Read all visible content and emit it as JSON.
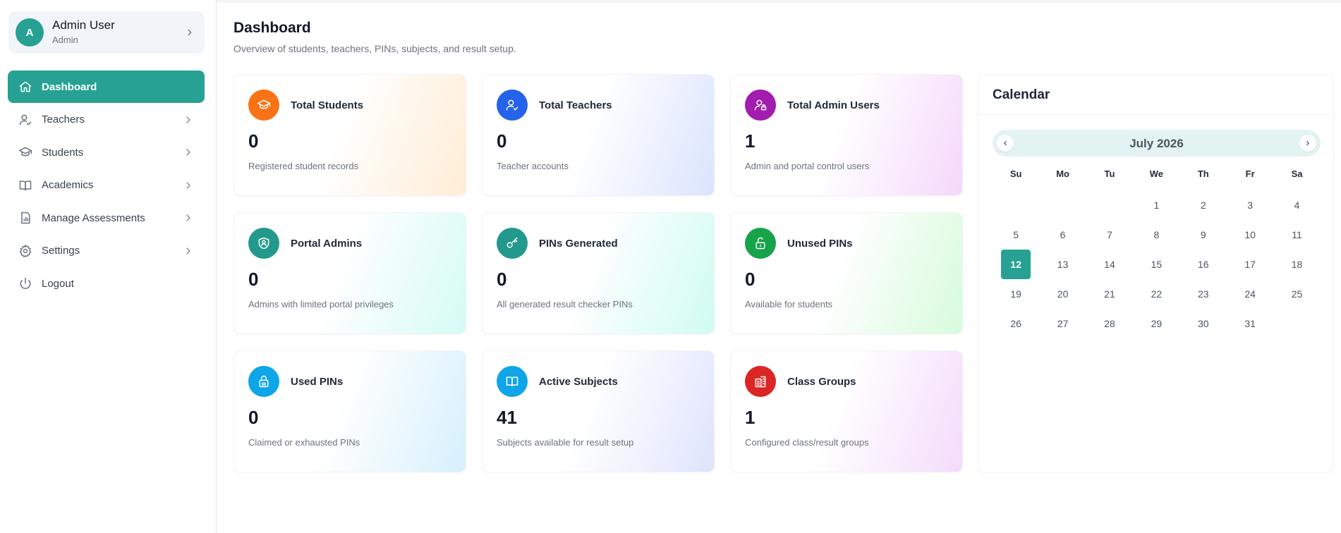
{
  "user": {
    "initial": "A",
    "name": "Admin User",
    "role": "Admin"
  },
  "nav": [
    {
      "label": "Dashboard",
      "icon": "home-icon",
      "active": true,
      "chevron": false
    },
    {
      "label": "Teachers",
      "icon": "user-check-icon",
      "active": false,
      "chevron": true
    },
    {
      "label": "Students",
      "icon": "graduation-cap-icon",
      "active": false,
      "chevron": true
    },
    {
      "label": "Academics",
      "icon": "book-open-icon",
      "active": false,
      "chevron": true
    },
    {
      "label": "Manage Assessments",
      "icon": "report-chart-icon",
      "active": false,
      "chevron": true
    },
    {
      "label": "Settings",
      "icon": "gear-icon",
      "active": false,
      "chevron": true
    },
    {
      "label": "Logout",
      "icon": "power-icon",
      "active": false,
      "chevron": false
    }
  ],
  "page": {
    "title": "Dashboard",
    "subtitle": "Overview of students, teachers, PINs, subjects, and result setup."
  },
  "cards": [
    {
      "title": "Total Students",
      "value": "0",
      "desc": "Registered student records",
      "icon": "graduation-cap-icon",
      "color": "#f97316",
      "tint": "#ffedd5"
    },
    {
      "title": "Total Teachers",
      "value": "0",
      "desc": "Teacher accounts",
      "icon": "user-check-icon",
      "color": "#2563eb",
      "tint": "#dbe4fe"
    },
    {
      "title": "Total Admin Users",
      "value": "1",
      "desc": "Admin and portal control users",
      "icon": "user-lock-icon",
      "color": "#a21caf",
      "tint": "#f5d8fb"
    },
    {
      "title": "Portal Admins",
      "value": "0",
      "desc": "Admins with limited portal privileges",
      "icon": "shield-user-icon",
      "color": "#22998c",
      "tint": "#d5fbf4"
    },
    {
      "title": "PINs Generated",
      "value": "0",
      "desc": "All generated result checker PINs",
      "icon": "key-icon",
      "color": "#22998c",
      "tint": "#cffcf2"
    },
    {
      "title": "Unused PINs",
      "value": "0",
      "desc": "Available for students",
      "icon": "unlock-icon",
      "color": "#16a34a",
      "tint": "#d7fbdc"
    },
    {
      "title": "Used PINs",
      "value": "0",
      "desc": "Claimed or exhausted PINs",
      "icon": "lock-icon",
      "color": "#0ea5e9",
      "tint": "#d6f0fd"
    },
    {
      "title": "Active Subjects",
      "value": "41",
      "desc": "Subjects available for result setup",
      "icon": "book-open-icon",
      "color": "#0ea5e9",
      "tint": "#dfe4fd"
    },
    {
      "title": "Class Groups",
      "value": "1",
      "desc": "Configured class/result groups",
      "icon": "building-icon",
      "color": "#dc2626",
      "tint": "#f4dbfb"
    }
  ],
  "calendar": {
    "title": "Calendar",
    "month_label": "July 2026",
    "weekdays": [
      "Su",
      "Mo",
      "Tu",
      "We",
      "Th",
      "Fr",
      "Sa"
    ],
    "first_weekday_index": 3,
    "days_in_month": 31,
    "today": 12
  }
}
